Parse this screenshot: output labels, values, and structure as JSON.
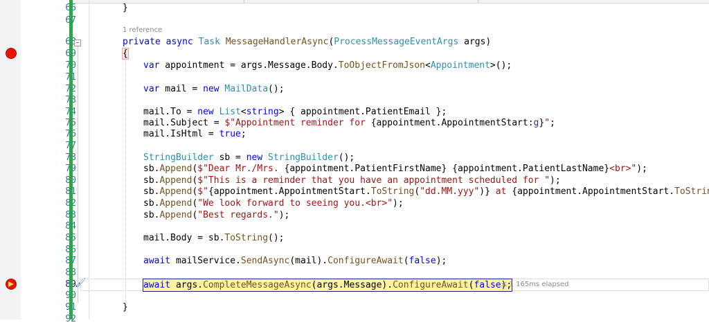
{
  "editor": {
    "reference_hint": "1 reference",
    "elapsed_hint": "≤ 1 165ms elapsed",
    "line_numbers": [
      "66",
      "67",
      "68",
      "69",
      "70",
      "71",
      "72",
      "73",
      "74",
      "75",
      "76",
      "77",
      "78",
      "79",
      "80",
      "81",
      "82",
      "83",
      "84",
      "85",
      "86",
      "87",
      "88",
      "89",
      "90",
      "91",
      "92"
    ],
    "lines": {
      "l66": "}",
      "l68": "private async Task MessageHandlerAsync(ProcessMessageEventArgs args)",
      "l69": "{",
      "l70": "var appointment = args.Message.Body.ToObjectFromJson<Appointment>();",
      "l72": "var mail = new MailData();",
      "l74": "mail.To = new List<string> { appointment.PatientEmail };",
      "l75": "mail.Subject = $\"Appointment reminder for {appointment.AppointmentStart:g}\";",
      "l76": "mail.IsHtml = true;",
      "l78": "StringBuilder sb = new StringBuilder();",
      "l79": "sb.Append($\"Dear Mr./Mrs. {appointment.PatientFirstName} {appointment.PatientLastName}<br>\");",
      "l80": "sb.Append($\"This is a reminder that you have an appointment scheduled for \");",
      "l81": "sb.Append($\"{appointment.AppointmentStart.ToString(\"dd.MM.yyy\")} at {appointment.AppointmentStart.ToString(\"H:",
      "l82": "sb.Append(\"We look forward to seeing you.<br>\");",
      "l83": "sb.Append(\"Best regards.\");",
      "l85": "mail.Body = sb.ToString();",
      "l87": "await mailService.SendAsync(mail).ConfigureAwait(false);",
      "l89": "await args.CompleteMessageAsync(args.Message).ConfigureAwait(false);",
      "l91": "}"
    }
  },
  "colors": {
    "keyword": "#0000ff",
    "type": "#2b91af",
    "method": "#74531f",
    "string": "#a31515",
    "breakpoint": "#e51400",
    "current_statement": "#fff3a0",
    "change_bar": "#2da44e"
  },
  "icons": {
    "breakpoint": "breakpoint-icon",
    "current_breakpoint": "current-statement-breakpoint-icon",
    "brush": "paint-brush-icon",
    "collapse": "collapse-minus-icon"
  }
}
